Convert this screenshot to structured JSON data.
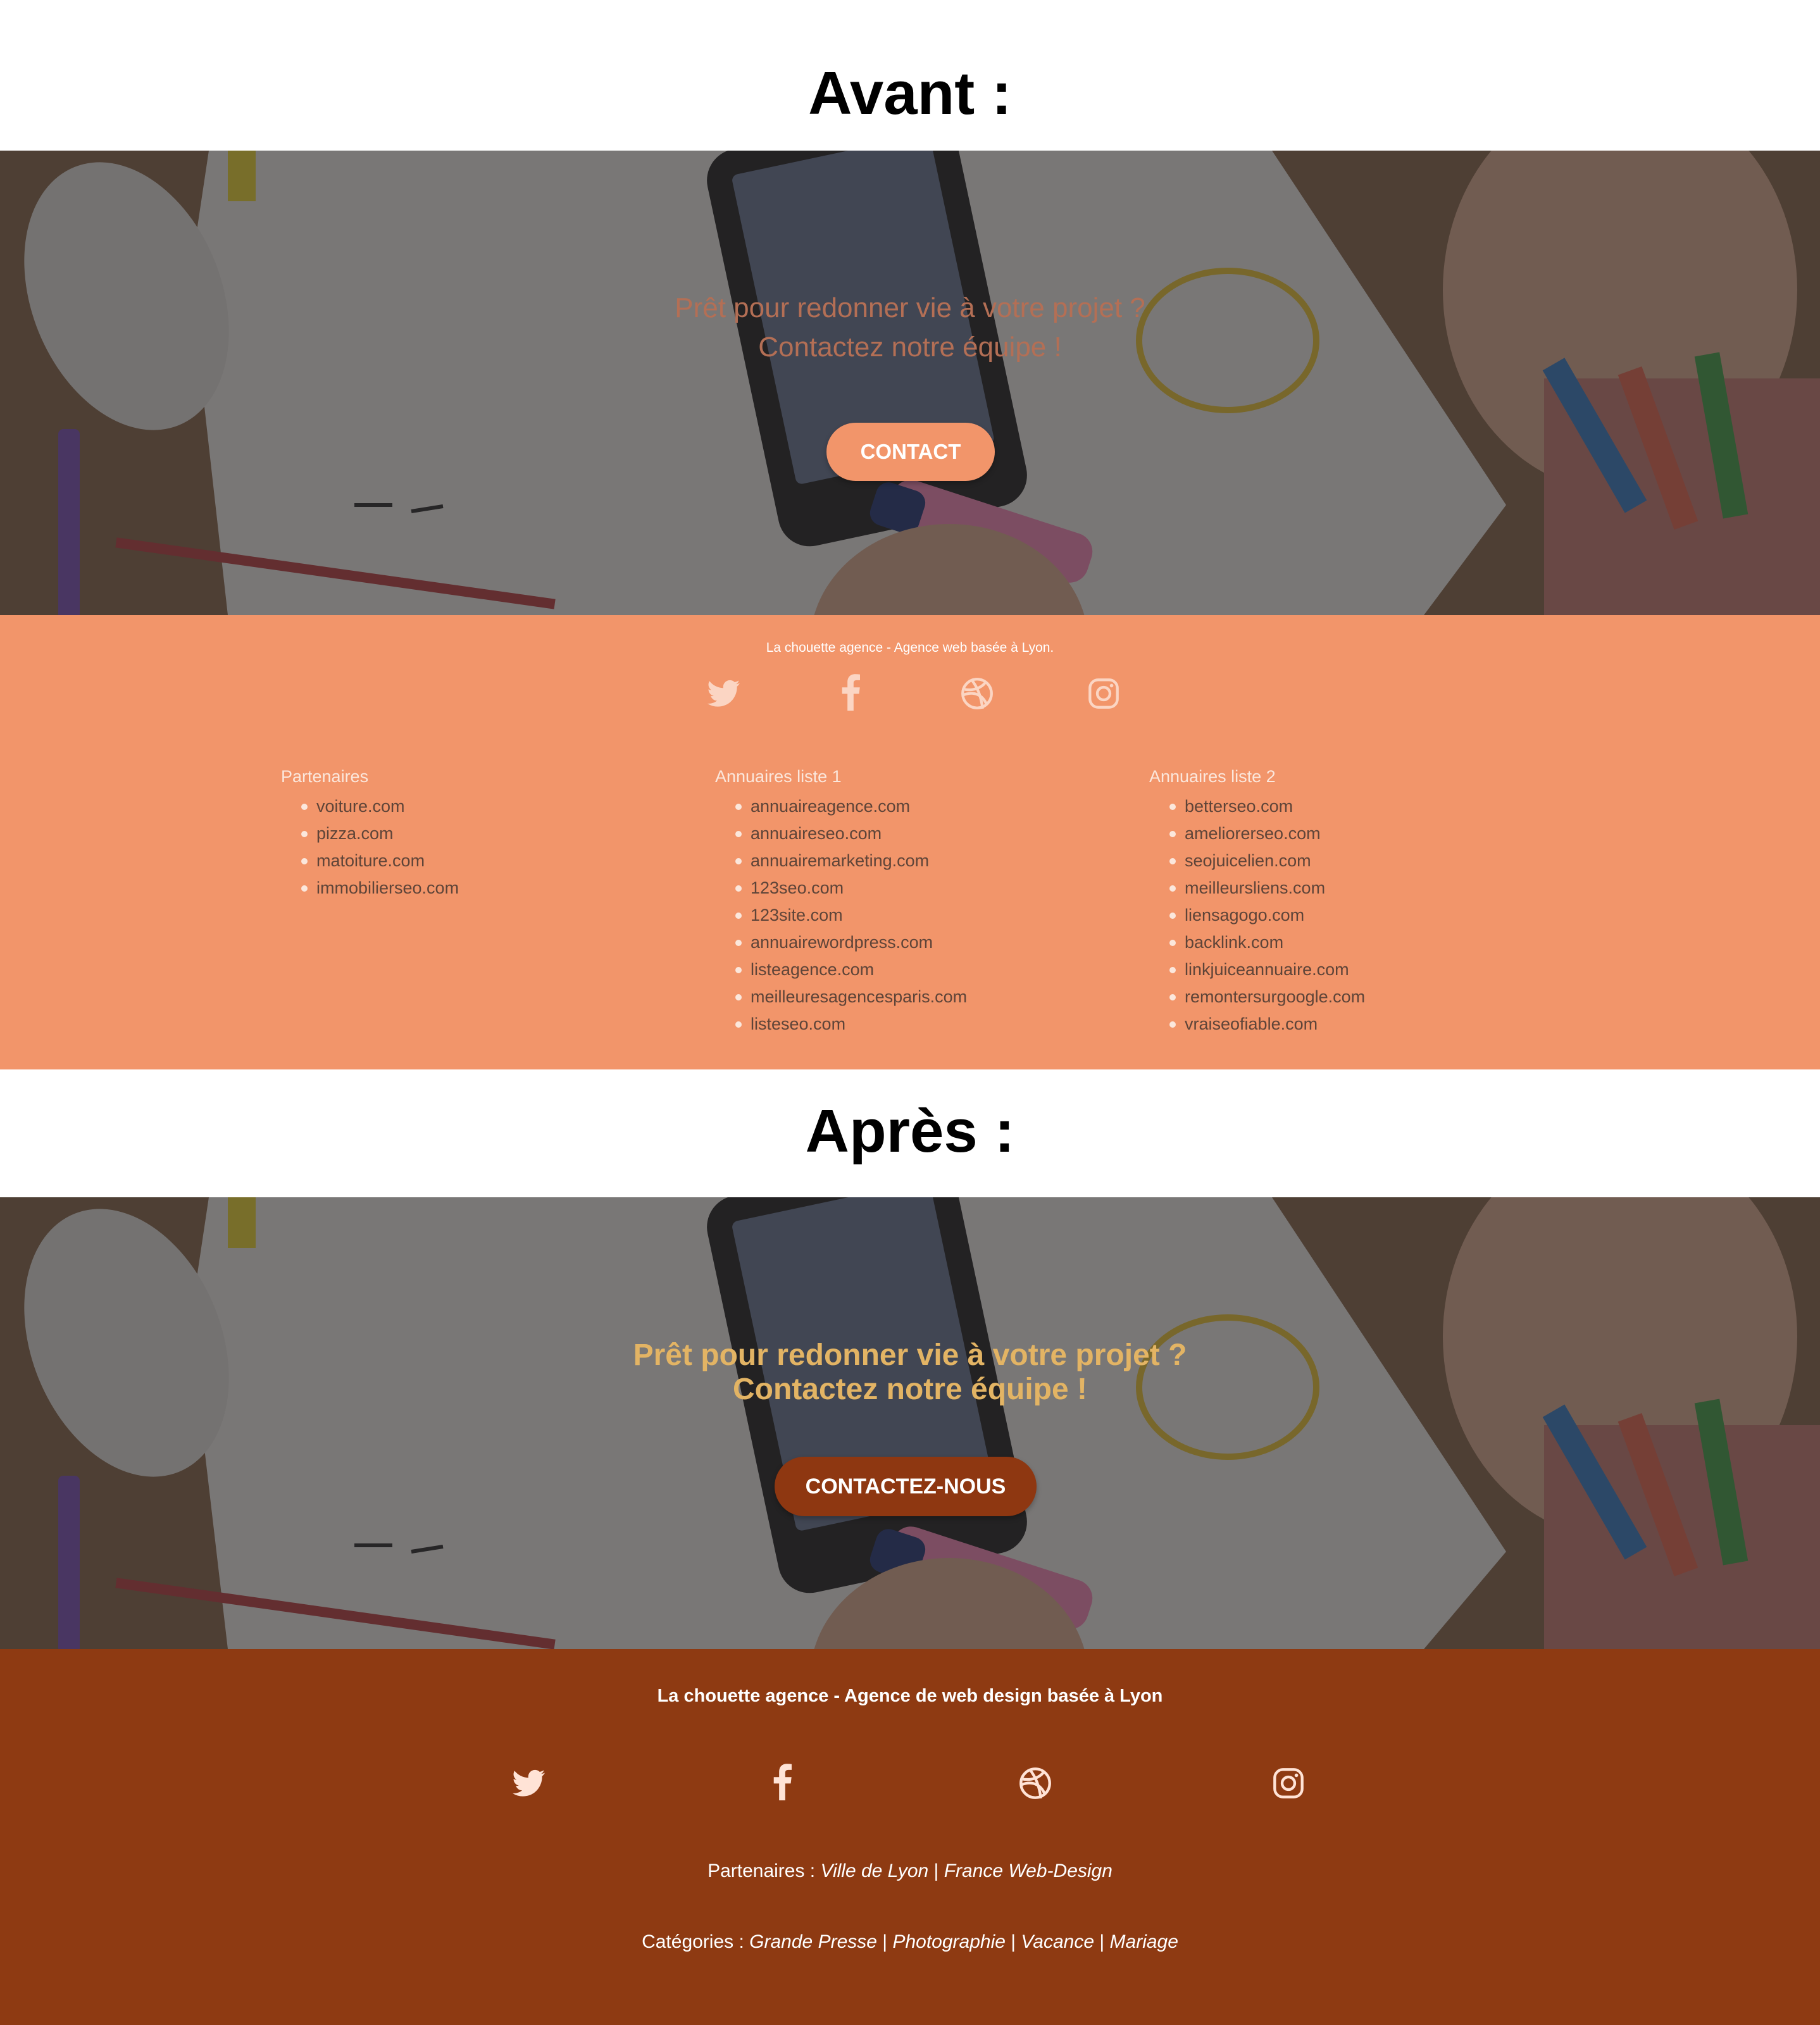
{
  "before": {
    "heading": "Avant :",
    "hero_line1": "Prêt pour redonner vie à votre projet ?",
    "hero_line2": "Contactez notre équipe !",
    "button": "CONTACT",
    "tagline": "La chouette agence - Agence web basée à Lyon.",
    "social": [
      "twitter-icon",
      "facebook-icon",
      "dribbble-icon",
      "instagram-icon"
    ],
    "columns": [
      {
        "title": "Partenaires",
        "items": [
          "voiture.com",
          "pizza.com",
          "matoiture.com",
          "immobilierseo.com"
        ]
      },
      {
        "title": "Annuaires liste 1",
        "items": [
          "annuaireagence.com",
          "annuaireseo.com",
          "annuairemarketing.com",
          "123seo.com",
          "123site.com",
          "annuairewordpress.com",
          "listeagence.com",
          "meilleuresagencesparis.com",
          "listeseo.com"
        ]
      },
      {
        "title": "Annuaires liste 2",
        "items": [
          "betterseo.com",
          "ameliorerseo.com",
          "seojuicelien.com",
          "meilleursliens.com",
          "liensagogo.com",
          "backlink.com",
          "linkjuiceannuaire.com",
          "remontersurgoogle.com",
          "vraiseofiable.com"
        ]
      }
    ],
    "colors": {
      "accent": "#f2956a",
      "hero_text": "#b46f55"
    }
  },
  "after": {
    "heading": "Après :",
    "hero_line1": "Prêt pour redonner vie à votre projet ?",
    "hero_line2": "Contactez notre équipe !",
    "button": "CONTACTEZ-NOUS",
    "tagline": "La chouette agence - Agence de web design basée à Lyon",
    "social": [
      "twitter-icon",
      "facebook-icon",
      "dribbble-icon",
      "instagram-icon"
    ],
    "partners_label": "Partenaires :",
    "partners": [
      "Ville de Lyon",
      "France Web-Design"
    ],
    "separator": "|",
    "categories_label": "Catégories :",
    "categories": [
      "Grande Presse",
      "Photographie",
      "Vacance",
      "Mariage"
    ],
    "colors": {
      "accent": "#8e3a12",
      "hero_text": "#e3b464"
    }
  }
}
